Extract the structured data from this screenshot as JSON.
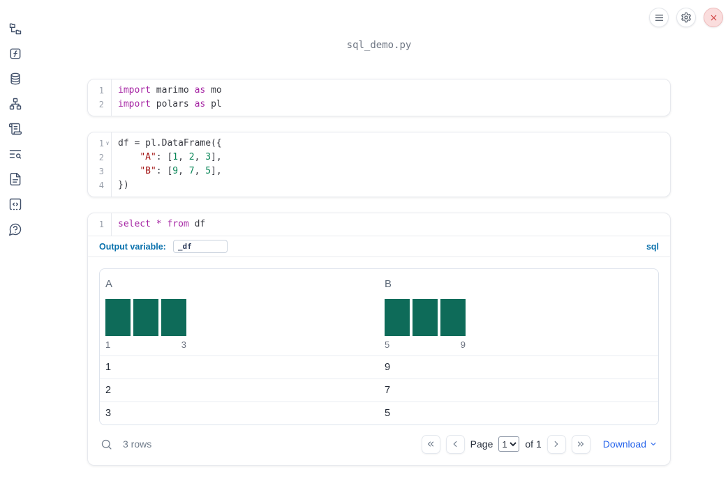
{
  "colors": {
    "keyword": "#a626a4",
    "string": "#a31515",
    "number": "#098658",
    "histogram_bar": "#0e6b59",
    "label_blue": "#0b72ad",
    "link_blue": "#2563eb",
    "close_red": "#cf3d3d"
  },
  "title": "sql_demo.py",
  "sidebar": {
    "items": [
      {
        "icon": "file-tree"
      },
      {
        "icon": "variables"
      },
      {
        "icon": "data-sources"
      },
      {
        "icon": "dependency-graph"
      },
      {
        "icon": "logs"
      },
      {
        "icon": "outline-search"
      },
      {
        "icon": "documentation"
      },
      {
        "icon": "snippets"
      },
      {
        "icon": "help"
      }
    ]
  },
  "toolbar": {
    "buttons": [
      {
        "icon": "menu"
      },
      {
        "icon": "settings"
      },
      {
        "icon": "close"
      }
    ]
  },
  "cells": [
    {
      "type": "code",
      "lines": [
        {
          "n": "1",
          "tokens": [
            [
              "kw",
              "import"
            ],
            [
              "txt",
              " marimo "
            ],
            [
              "kw",
              "as"
            ],
            [
              "txt",
              " mo"
            ]
          ]
        },
        {
          "n": "2",
          "tokens": [
            [
              "kw",
              "import"
            ],
            [
              "txt",
              " polars "
            ],
            [
              "kw",
              "as"
            ],
            [
              "txt",
              " pl"
            ]
          ]
        }
      ]
    },
    {
      "type": "code",
      "lines": [
        {
          "n": "1",
          "fold": true,
          "tokens": [
            [
              "txt",
              "df = pl.DataFrame({"
            ]
          ]
        },
        {
          "n": "2",
          "tokens": [
            [
              "txt",
              "    "
            ],
            [
              "str",
              "\"A\""
            ],
            [
              "txt",
              ": ["
            ],
            [
              "num",
              "1"
            ],
            [
              "txt",
              ", "
            ],
            [
              "num",
              "2"
            ],
            [
              "txt",
              ", "
            ],
            [
              "num",
              "3"
            ],
            [
              "txt",
              "],"
            ]
          ]
        },
        {
          "n": "3",
          "tokens": [
            [
              "txt",
              "    "
            ],
            [
              "str",
              "\"B\""
            ],
            [
              "txt",
              ": ["
            ],
            [
              "num",
              "9"
            ],
            [
              "txt",
              ", "
            ],
            [
              "num",
              "7"
            ],
            [
              "txt",
              ", "
            ],
            [
              "num",
              "5"
            ],
            [
              "txt",
              "],"
            ]
          ]
        },
        {
          "n": "4",
          "tokens": [
            [
              "txt",
              "})"
            ]
          ]
        }
      ]
    },
    {
      "type": "sql",
      "lines": [
        {
          "n": "1",
          "tokens": [
            [
              "kw",
              "select"
            ],
            [
              "txt",
              " "
            ],
            [
              "kw",
              "*"
            ],
            [
              "txt",
              " "
            ],
            [
              "kw",
              "from"
            ],
            [
              "txt",
              " df"
            ]
          ]
        }
      ],
      "output_variable_label": "Output variable:",
      "output_variable_value": "_df",
      "language_badge": "sql"
    }
  ],
  "table": {
    "columns": [
      {
        "name": "A",
        "hist": {
          "bars": [
            1,
            1,
            1
          ],
          "min_label": "1",
          "max_label": "3"
        }
      },
      {
        "name": "B",
        "hist": {
          "bars": [
            1,
            1,
            1
          ],
          "min_label": "5",
          "max_label": "9"
        }
      }
    ],
    "rows": [
      [
        "1",
        "9"
      ],
      [
        "2",
        "7"
      ],
      [
        "3",
        "5"
      ]
    ],
    "footer": {
      "row_count": "3 rows",
      "page_label": "Page",
      "page_value": "1",
      "of_label": "of 1",
      "download_label": "Download"
    }
  }
}
